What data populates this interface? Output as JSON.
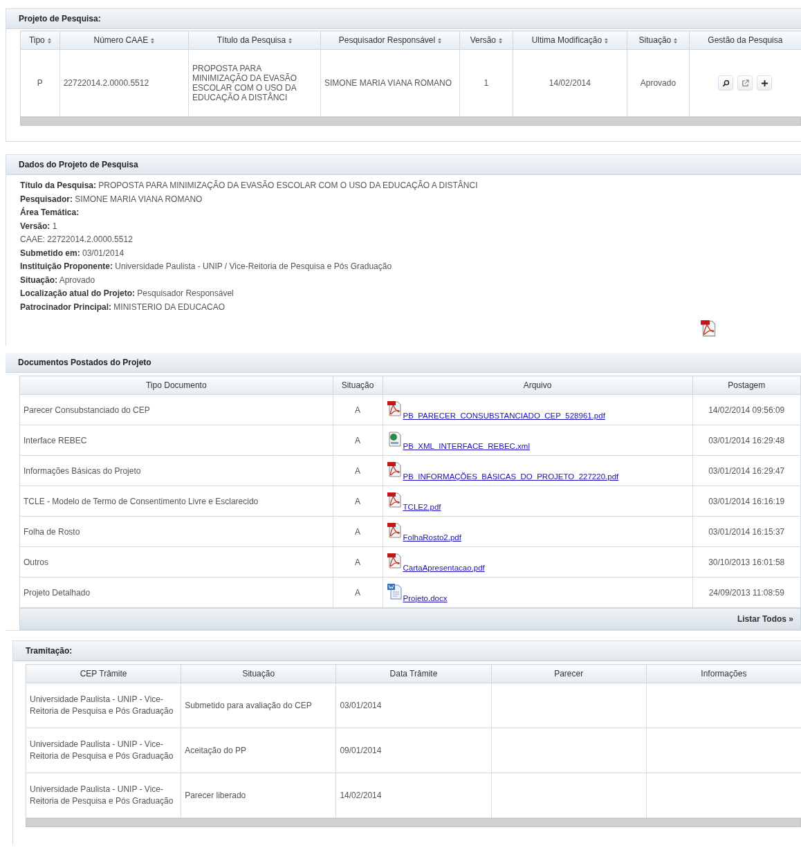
{
  "projeto": {
    "title": "Projeto de Pesquisa:",
    "columns": [
      {
        "label": "Tipo",
        "sortable": true
      },
      {
        "label": "Número CAAE",
        "sortable": true
      },
      {
        "label": "Título da Pesquisa",
        "sortable": true
      },
      {
        "label": "Pesquisador Responsável",
        "sortable": true
      },
      {
        "label": "Versão",
        "sortable": true
      },
      {
        "label": "Ultima Modificação",
        "sortable": true
      },
      {
        "label": "Situação",
        "sortable": true
      },
      {
        "label": "Gestão da Pesquisa",
        "sortable": false
      }
    ],
    "row": {
      "tipo": "P",
      "caae": "22722014.2.0000.5512",
      "titulo": "PROPOSTA PARA MINIMIZAÇÃO DA EVASÃO ESCOLAR COM O USO DA EDUCAÇÃO A DISTÂNCI",
      "pesquisador": "SIMONE MARIA VIANA ROMANO",
      "versao": "1",
      "modificacao": "14/02/2014",
      "situacao": "Aprovado",
      "actions": [
        {
          "kind": "view"
        },
        {
          "kind": "open"
        },
        {
          "kind": "add"
        }
      ]
    }
  },
  "dados": {
    "title": "Dados do Projeto de Pesquisa",
    "lines": [
      "**Título da Pesquisa:** PROPOSTA PARA MINIMIZAÇÃO DA EVASÃO ESCOLAR COM O USO DA EDUCAÇÃO A DISTÂNCI",
      "**Pesquisador:** SIMONE MARIA VIANA ROMANO",
      "**Área Temática:**",
      "**Versão:** 1",
      "CAAE: 22722014.2.0000.5512",
      "**Submetido em:** 03/01/2014",
      "**Instituição Proponente:** Universidade Paulista - UNIP / Vice-Reitoria de Pesquisa e Pós Graduação",
      "**Situação:** Aprovado",
      "**Localização atual do Projeto:** Pesquisador Responsável",
      "**Patrocinador Principal:** MINISTERIO DA EDUCACAO"
    ]
  },
  "documentos": {
    "title": "Documentos Postados do Projeto",
    "columns": [
      "Tipo Documento",
      "Situação",
      "Arquivo",
      "Postagem"
    ],
    "rows": [
      {
        "tipo": "Parecer Consubstanciado do CEP",
        "situacao": "A",
        "kind": "pdf",
        "arquivo": "PB_PARECER_CONSUBSTANCIADO_CEP_528961.pdf",
        "postagem": "14/02/2014 09:56:09"
      },
      {
        "tipo": "Interface REBEC",
        "situacao": "A",
        "kind": "xml",
        "arquivo": "PB_XML_INTERFACE_REBEC.xml",
        "postagem": "03/01/2014 16:29:48"
      },
      {
        "tipo": "Informações Básicas do Projeto",
        "situacao": "A",
        "kind": "pdf",
        "arquivo": "PB_INFORMAÇÕES_BÁSICAS_DO_PROJETO_227220.pdf",
        "postagem": "03/01/2014 16:29:47"
      },
      {
        "tipo": "TCLE - Modelo de Termo de Consentimento Livre e Esclarecido",
        "situacao": "A",
        "kind": "pdf",
        "arquivo": "TCLE2.pdf",
        "postagem": "03/01/2014 16:16:19"
      },
      {
        "tipo": "Folha de Rosto",
        "situacao": "A",
        "kind": "pdf",
        "arquivo": "FolhaRosto2.pdf",
        "postagem": "03/01/2014 16:15:37"
      },
      {
        "tipo": "Outros",
        "situacao": "A",
        "kind": "pdf",
        "arquivo": "CartaApresentacao.pdf",
        "postagem": "30/10/2013 16:01:58"
      },
      {
        "tipo": "Projeto Detalhado",
        "situacao": "A",
        "kind": "doc",
        "arquivo": "Projeto.docx",
        "postagem": "24/09/2013 11:08:59"
      }
    ],
    "footer_link": "Listar Todos »"
  },
  "tramitacao": {
    "title": "Tramitação:",
    "columns": [
      "CEP Trâmite",
      "Situação",
      "Data Trâmite",
      "Parecer",
      "Informações"
    ],
    "rows": [
      {
        "cep": "Universidade Paulista - UNIP - Vice-Reitoria de Pesquisa e Pós Graduação",
        "situacao": "Submetido para avaliação do CEP",
        "data": "03/01/2014"
      },
      {
        "cep": "Universidade Paulista - UNIP - Vice-Reitoria de Pesquisa e Pós Graduação",
        "situacao": "Aceitação do PP",
        "data": "09/01/2014"
      },
      {
        "cep": "Universidade Paulista - UNIP - Vice-Reitoria de Pesquisa e Pós Graduação",
        "situacao": "Parecer liberado",
        "data": "14/02/2014"
      }
    ]
  }
}
